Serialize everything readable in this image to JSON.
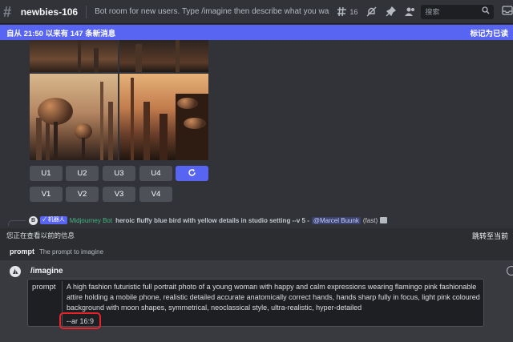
{
  "header": {
    "channel": "newbies-106",
    "topic": "Bot room for new users. Type /imagine then describe what you want to draw...",
    "thread_count": "16",
    "search_placeholder": "搜索",
    "icons": [
      "threads-icon",
      "mute-icon",
      "pin-icon",
      "members-icon",
      "search-icon",
      "inbox-icon"
    ]
  },
  "new_messages_bar": {
    "text": "自从 21:50 以来有 147 条新消息",
    "mark_read": "标记为已读"
  },
  "image_grid": {
    "upscale_buttons": [
      "U1",
      "U2",
      "U3",
      "U4"
    ],
    "variation_buttons": [
      "V1",
      "V2",
      "V3",
      "V4"
    ]
  },
  "bot_message": {
    "avatar_letter": "B",
    "tag": "✓ 机器人",
    "bot_name": "Midjourney Bot",
    "text": "heroic fluffy blue bird with yellow details in studio setting --v 5 -",
    "mention": "@Marcel Buunk",
    "speed": "(fast)"
  },
  "older_messages_bar": {
    "text": "您正在查看以前的信息",
    "jump": "跳转至当前"
  },
  "command_hint": {
    "name": "prompt",
    "description": "The prompt to imagine"
  },
  "composer": {
    "command": "/imagine",
    "prompt_label": "prompt",
    "prompt_text": "A high fashion futuristic full portrait photo of a young woman with happy and calm expressions wearing flamingo pink fashionable attire holding a mobile phone, realistic detailed accurate anatomically correct hands, hands sharp fully in focus, light pink coloured background with moon shapes, symmetrical, neoclassical style, ultra-realistic, hyper-detailed",
    "aspect_flag": "--ar 16:9"
  },
  "colors": {
    "blurple": "#5865f2",
    "highlight_red": "#e8232a",
    "bot_green": "#43b581"
  }
}
